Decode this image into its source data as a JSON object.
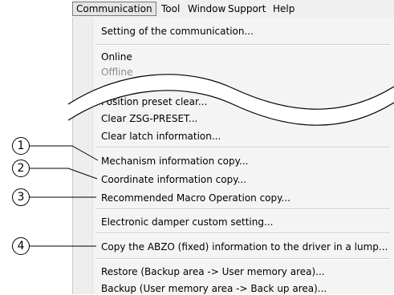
{
  "menubar": {
    "items": [
      "Communication",
      "Tool",
      "Window",
      "Support",
      "Help"
    ]
  },
  "menu": {
    "items": {
      "setting_comm": "Setting of the communication...",
      "online": "Online",
      "offline": "Offline",
      "position_preset_clear": "Position preset clear...",
      "clear_zsg_preset": "Clear ZSG-PRESET...",
      "clear_latch_info": "Clear latch information...",
      "mechanism_info_copy": "Mechanism information copy...",
      "coordinate_info_copy": "Coordinate information copy...",
      "recommended_macro_copy": "Recommended Macro Operation copy...",
      "electronic_damper": "Electronic damper custom setting...",
      "copy_abzo": "Copy the ABZO (fixed) information to the driver in a lump...",
      "restore": "Restore (Backup area -> User memory area)...",
      "backup": "Backup (User memory area -> Back up area)..."
    }
  },
  "callouts": [
    "1",
    "2",
    "3",
    "4"
  ],
  "colors": {
    "menu_bg": "#f4f4f4",
    "menubar_bg": "#f0f0f0",
    "disabled_text": "#8c8c8c"
  }
}
